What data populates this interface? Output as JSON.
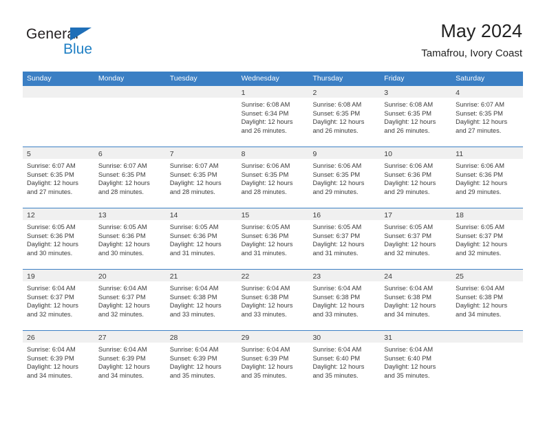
{
  "brand": {
    "name_part1": "General",
    "name_part2": "Blue",
    "flag_icon": "blue-triangle-flag-icon"
  },
  "header": {
    "title": "May 2024",
    "subtitle": "Tamafrou, Ivory Coast"
  },
  "colors": {
    "header_blue": "#3b7fc4",
    "brand_blue": "#1f7fc4",
    "day_band_gray": "#f0f0f0",
    "text": "#3a3a3a"
  },
  "weekdays": [
    "Sunday",
    "Monday",
    "Tuesday",
    "Wednesday",
    "Thursday",
    "Friday",
    "Saturday"
  ],
  "weeks": [
    [
      {
        "day": "",
        "empty": true
      },
      {
        "day": "",
        "empty": true
      },
      {
        "day": "",
        "empty": true
      },
      {
        "day": "1",
        "sunrise": "Sunrise: 6:08 AM",
        "sunset": "Sunset: 6:34 PM",
        "daylight1": "Daylight: 12 hours",
        "daylight2": "and 26 minutes."
      },
      {
        "day": "2",
        "sunrise": "Sunrise: 6:08 AM",
        "sunset": "Sunset: 6:35 PM",
        "daylight1": "Daylight: 12 hours",
        "daylight2": "and 26 minutes."
      },
      {
        "day": "3",
        "sunrise": "Sunrise: 6:08 AM",
        "sunset": "Sunset: 6:35 PM",
        "daylight1": "Daylight: 12 hours",
        "daylight2": "and 26 minutes."
      },
      {
        "day": "4",
        "sunrise": "Sunrise: 6:07 AM",
        "sunset": "Sunset: 6:35 PM",
        "daylight1": "Daylight: 12 hours",
        "daylight2": "and 27 minutes."
      }
    ],
    [
      {
        "day": "5",
        "sunrise": "Sunrise: 6:07 AM",
        "sunset": "Sunset: 6:35 PM",
        "daylight1": "Daylight: 12 hours",
        "daylight2": "and 27 minutes."
      },
      {
        "day": "6",
        "sunrise": "Sunrise: 6:07 AM",
        "sunset": "Sunset: 6:35 PM",
        "daylight1": "Daylight: 12 hours",
        "daylight2": "and 28 minutes."
      },
      {
        "day": "7",
        "sunrise": "Sunrise: 6:07 AM",
        "sunset": "Sunset: 6:35 PM",
        "daylight1": "Daylight: 12 hours",
        "daylight2": "and 28 minutes."
      },
      {
        "day": "8",
        "sunrise": "Sunrise: 6:06 AM",
        "sunset": "Sunset: 6:35 PM",
        "daylight1": "Daylight: 12 hours",
        "daylight2": "and 28 minutes."
      },
      {
        "day": "9",
        "sunrise": "Sunrise: 6:06 AM",
        "sunset": "Sunset: 6:35 PM",
        "daylight1": "Daylight: 12 hours",
        "daylight2": "and 29 minutes."
      },
      {
        "day": "10",
        "sunrise": "Sunrise: 6:06 AM",
        "sunset": "Sunset: 6:36 PM",
        "daylight1": "Daylight: 12 hours",
        "daylight2": "and 29 minutes."
      },
      {
        "day": "11",
        "sunrise": "Sunrise: 6:06 AM",
        "sunset": "Sunset: 6:36 PM",
        "daylight1": "Daylight: 12 hours",
        "daylight2": "and 29 minutes."
      }
    ],
    [
      {
        "day": "12",
        "sunrise": "Sunrise: 6:05 AM",
        "sunset": "Sunset: 6:36 PM",
        "daylight1": "Daylight: 12 hours",
        "daylight2": "and 30 minutes."
      },
      {
        "day": "13",
        "sunrise": "Sunrise: 6:05 AM",
        "sunset": "Sunset: 6:36 PM",
        "daylight1": "Daylight: 12 hours",
        "daylight2": "and 30 minutes."
      },
      {
        "day": "14",
        "sunrise": "Sunrise: 6:05 AM",
        "sunset": "Sunset: 6:36 PM",
        "daylight1": "Daylight: 12 hours",
        "daylight2": "and 31 minutes."
      },
      {
        "day": "15",
        "sunrise": "Sunrise: 6:05 AM",
        "sunset": "Sunset: 6:36 PM",
        "daylight1": "Daylight: 12 hours",
        "daylight2": "and 31 minutes."
      },
      {
        "day": "16",
        "sunrise": "Sunrise: 6:05 AM",
        "sunset": "Sunset: 6:37 PM",
        "daylight1": "Daylight: 12 hours",
        "daylight2": "and 31 minutes."
      },
      {
        "day": "17",
        "sunrise": "Sunrise: 6:05 AM",
        "sunset": "Sunset: 6:37 PM",
        "daylight1": "Daylight: 12 hours",
        "daylight2": "and 32 minutes."
      },
      {
        "day": "18",
        "sunrise": "Sunrise: 6:05 AM",
        "sunset": "Sunset: 6:37 PM",
        "daylight1": "Daylight: 12 hours",
        "daylight2": "and 32 minutes."
      }
    ],
    [
      {
        "day": "19",
        "sunrise": "Sunrise: 6:04 AM",
        "sunset": "Sunset: 6:37 PM",
        "daylight1": "Daylight: 12 hours",
        "daylight2": "and 32 minutes."
      },
      {
        "day": "20",
        "sunrise": "Sunrise: 6:04 AM",
        "sunset": "Sunset: 6:37 PM",
        "daylight1": "Daylight: 12 hours",
        "daylight2": "and 32 minutes."
      },
      {
        "day": "21",
        "sunrise": "Sunrise: 6:04 AM",
        "sunset": "Sunset: 6:38 PM",
        "daylight1": "Daylight: 12 hours",
        "daylight2": "and 33 minutes."
      },
      {
        "day": "22",
        "sunrise": "Sunrise: 6:04 AM",
        "sunset": "Sunset: 6:38 PM",
        "daylight1": "Daylight: 12 hours",
        "daylight2": "and 33 minutes."
      },
      {
        "day": "23",
        "sunrise": "Sunrise: 6:04 AM",
        "sunset": "Sunset: 6:38 PM",
        "daylight1": "Daylight: 12 hours",
        "daylight2": "and 33 minutes."
      },
      {
        "day": "24",
        "sunrise": "Sunrise: 6:04 AM",
        "sunset": "Sunset: 6:38 PM",
        "daylight1": "Daylight: 12 hours",
        "daylight2": "and 34 minutes."
      },
      {
        "day": "25",
        "sunrise": "Sunrise: 6:04 AM",
        "sunset": "Sunset: 6:38 PM",
        "daylight1": "Daylight: 12 hours",
        "daylight2": "and 34 minutes."
      }
    ],
    [
      {
        "day": "26",
        "sunrise": "Sunrise: 6:04 AM",
        "sunset": "Sunset: 6:39 PM",
        "daylight1": "Daylight: 12 hours",
        "daylight2": "and 34 minutes."
      },
      {
        "day": "27",
        "sunrise": "Sunrise: 6:04 AM",
        "sunset": "Sunset: 6:39 PM",
        "daylight1": "Daylight: 12 hours",
        "daylight2": "and 34 minutes."
      },
      {
        "day": "28",
        "sunrise": "Sunrise: 6:04 AM",
        "sunset": "Sunset: 6:39 PM",
        "daylight1": "Daylight: 12 hours",
        "daylight2": "and 35 minutes."
      },
      {
        "day": "29",
        "sunrise": "Sunrise: 6:04 AM",
        "sunset": "Sunset: 6:39 PM",
        "daylight1": "Daylight: 12 hours",
        "daylight2": "and 35 minutes."
      },
      {
        "day": "30",
        "sunrise": "Sunrise: 6:04 AM",
        "sunset": "Sunset: 6:40 PM",
        "daylight1": "Daylight: 12 hours",
        "daylight2": "and 35 minutes."
      },
      {
        "day": "31",
        "sunrise": "Sunrise: 6:04 AM",
        "sunset": "Sunset: 6:40 PM",
        "daylight1": "Daylight: 12 hours",
        "daylight2": "and 35 minutes."
      },
      {
        "day": "",
        "empty": true
      }
    ]
  ]
}
